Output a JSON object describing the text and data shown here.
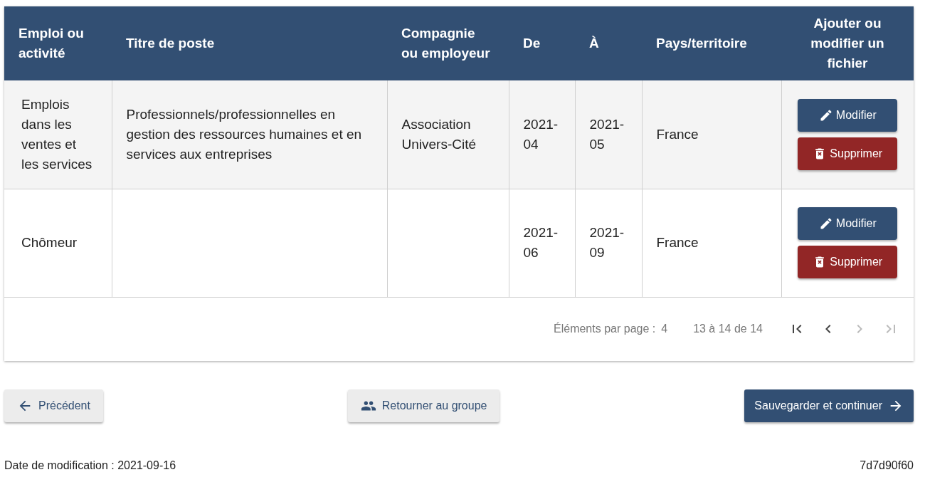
{
  "table": {
    "columns": [
      "Emploi ou activité",
      "Titre de poste",
      "Compagnie ou employeur",
      "De",
      "À",
      "Pays/territoire",
      "Ajouter ou modifier un fichier"
    ],
    "rows": [
      {
        "cells": [
          "Emplois dans les ventes et les services",
          "Professionnels/professionnelles en gestion des ressources humaines et en services aux entreprises",
          "Association Univers-Cité",
          "2021-04",
          "2021-05",
          "France"
        ],
        "actions": [
          {
            "kind": "edit",
            "label": "Modifier"
          },
          {
            "kind": "delete",
            "label": "Supprimer"
          }
        ]
      },
      {
        "cells": [
          "Chômeur",
          "",
          "",
          "2021-06",
          "2021-09",
          "France"
        ],
        "actions": [
          {
            "kind": "edit",
            "label": "Modifier"
          },
          {
            "kind": "delete",
            "label": "Supprimer"
          }
        ]
      }
    ]
  },
  "paginator": {
    "items_per_page_label": "Éléments par page :",
    "items_per_page": "4",
    "range": "13 à 14 de 14",
    "nav": [
      {
        "kind": "first",
        "disabled": false
      },
      {
        "kind": "prev",
        "disabled": false
      },
      {
        "kind": "next",
        "disabled": true
      },
      {
        "kind": "last",
        "disabled": true
      }
    ]
  },
  "buttons": [
    {
      "kind": "back",
      "label": "Précédent"
    },
    {
      "kind": "group",
      "label": "Retourner au groupe"
    },
    {
      "kind": "next",
      "label": "Sauvegarder et continuer"
    }
  ],
  "footer": {
    "modified": "Date de modification : 2021-09-16",
    "version": "7d7d90f60"
  }
}
